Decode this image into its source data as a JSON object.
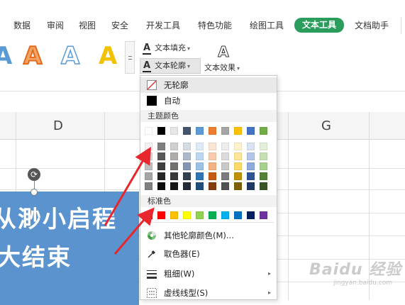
{
  "menu": {
    "tabs": [
      {
        "label": "数据",
        "active": false
      },
      {
        "label": "审阅",
        "active": false
      },
      {
        "label": "视图",
        "active": false
      },
      {
        "label": "安全",
        "active": false
      },
      {
        "label": "开发工具",
        "active": false
      },
      {
        "label": "特色功能",
        "active": false
      },
      {
        "label": "绘图工具",
        "active": false
      },
      {
        "label": "文本工具",
        "active": true
      },
      {
        "label": "文档助手",
        "active": false
      }
    ]
  },
  "ribbon": {
    "art_styles": [
      {
        "glyph": "A",
        "fill": "#5b9bd5",
        "stroke": "none"
      },
      {
        "glyph": "A",
        "fill": "#f4a460",
        "stroke": "#e06b1f"
      },
      {
        "glyph": "A",
        "fill": "#ffffff",
        "stroke": "#5b9bd5"
      },
      {
        "glyph": "A",
        "fill": "#f2c200",
        "stroke": "none"
      }
    ],
    "text_fill_label": "文本填充",
    "text_outline_label": "文本轮廓",
    "text_effect_label": "文本效果",
    "text_effect_glyph": "A",
    "glyph_a": "A",
    "dropdown_arrow": "▾"
  },
  "sheet": {
    "columns": [
      "D",
      "G"
    ],
    "textbox_lines": [
      "从渺小启程",
      "大结束"
    ],
    "textbox_color": "#5a93ce",
    "rotate_glyph": "⟳"
  },
  "outline_menu": {
    "no_outline": "无轮廓",
    "auto": "自动",
    "theme_colors_title": "主题颜色",
    "theme_top_row": [
      "#ffffff",
      "#000000",
      "#e7e6e6",
      "#44546a",
      "#5b9bd5",
      "#ed7d31",
      "#a5a5a5",
      "#ffc000",
      "#4472c4",
      "#70ad47"
    ],
    "theme_shades": [
      [
        "#f2f2f2",
        "#7f7f7f",
        "#d0cece",
        "#d6dce4",
        "#deebf6",
        "#fbe5d5",
        "#ededed",
        "#fff2cc",
        "#dae3f3",
        "#e2efd9"
      ],
      [
        "#d8d8d8",
        "#595959",
        "#aeabab",
        "#adb9ca",
        "#bdd7ee",
        "#f7cbac",
        "#dbdbdb",
        "#fee599",
        "#b4c6e7",
        "#c5e0b3"
      ],
      [
        "#bfbfbf",
        "#3f3f3f",
        "#757070",
        "#8496b0",
        "#9cc3e5",
        "#f4b183",
        "#c9c9c9",
        "#ffd965",
        "#8eaadb",
        "#a8d08d"
      ],
      [
        "#a5a5a5",
        "#262626",
        "#3a3838",
        "#323f4f",
        "#2e75b5",
        "#c55a11",
        "#7b7b7b",
        "#bf9000",
        "#2f5496",
        "#538135"
      ],
      [
        "#7f7f7f",
        "#0c0c0c",
        "#171616",
        "#222a35",
        "#1e4e79",
        "#833c0b",
        "#525252",
        "#7f6000",
        "#1f3864",
        "#375623"
      ]
    ],
    "standard_colors_title": "标准色",
    "standard_colors": [
      "#c00000",
      "#ff0000",
      "#ffc000",
      "#ffff00",
      "#92d050",
      "#00b050",
      "#00b0f0",
      "#0070c0",
      "#002060",
      "#7030a0"
    ],
    "more_colors": "其他轮廓颜色(M)...",
    "eyedropper": "取色器(E)",
    "weight": "粗细(W)",
    "dash_type": "虚线线型(S)",
    "submenu_arrow": "▸",
    "annotation_color": "#e8262d"
  },
  "watermark": {
    "brand": "Baidu 经验",
    "url": "jingyan.baidu.com"
  }
}
